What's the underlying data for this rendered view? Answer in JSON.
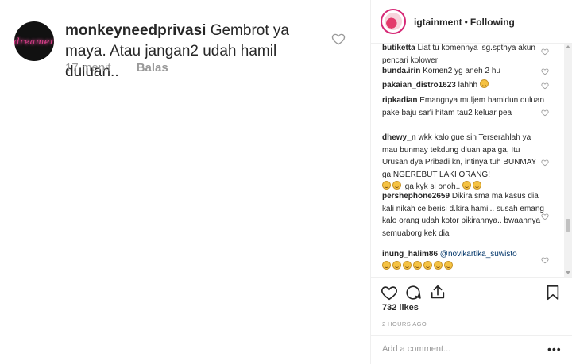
{
  "zoom_comment": {
    "avatar_text": "dreamer",
    "username": "monkeyneedprivasi",
    "text": "Gembrot ya maya. Atau jangan2 udah hamil duluan..",
    "time": "17 menit",
    "reply": "Balas"
  },
  "header": {
    "username": "igtainment",
    "separator": "•",
    "follow_status": "Following"
  },
  "comments": [
    {
      "user": "butiketta",
      "text": "Liat tu komennya isg.spthya akun pencari kolower"
    },
    {
      "user": "bunda.irin",
      "text": "Komen2 yg aneh 2 hu"
    },
    {
      "user": "pakaian_distro1623",
      "text": "lahhh"
    },
    {
      "user": "ripkadian",
      "text": "Emangnya muljem hamidun duluan pake baju sar'i hitam tau2 keluar pea"
    },
    {
      "user": "dhewy_n",
      "text": "wkk kalo gue sih Terserahlah ya mau bunmay tekdung dluan apa ga, Itu Urusan dya Pribadi kn, intinya tuh BUNMAY ga NGEREBUT LAKI ORANG!",
      "tail": "ga kyk si onoh.."
    },
    {
      "user": "pershephone2659",
      "text": "Dikira sma ma kasus dia kali nikah ce berisi d.kira hamil.. susah emang kalo orang udah kotor pikirannya.. bwaannya semuaborg kek dia"
    },
    {
      "user": "inung_halim86",
      "text": "@novikartika_suwisto"
    }
  ],
  "post": {
    "likes": "732 likes",
    "time": "2 HOURS AGO",
    "add_comment_placeholder": "Add a comment...",
    "more": "•••"
  },
  "colors": {
    "text": "#262626",
    "muted": "#999999",
    "border": "#efefef",
    "mention": "#003569",
    "ring": "#d62976"
  }
}
